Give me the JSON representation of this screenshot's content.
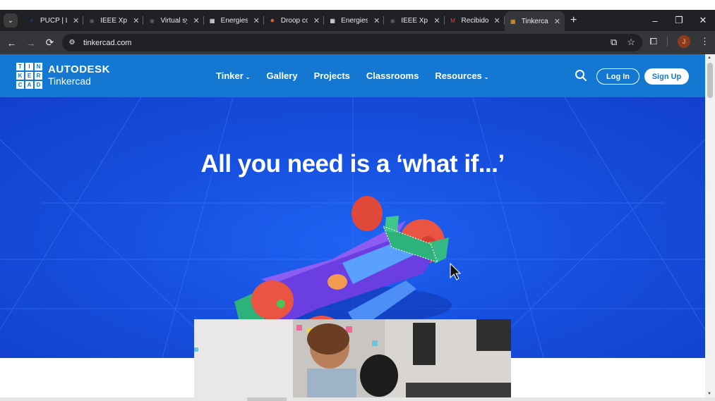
{
  "browser": {
    "tabs": [
      {
        "title": "PUCP | Lo",
        "favicon": "pucp-icon",
        "color": "#1a3b8c"
      },
      {
        "title": "IEEE Xplo",
        "favicon": "globe-icon",
        "color": "#5f6368"
      },
      {
        "title": "Virtual sy",
        "favicon": "globe-icon",
        "color": "#5f6368"
      },
      {
        "title": "Energies |",
        "favicon": "mdpi-icon",
        "color": "#ffffff"
      },
      {
        "title": "Droop co",
        "favicon": "star-icon",
        "color": "#e8632b"
      },
      {
        "title": "Energies |",
        "favicon": "mdpi-icon",
        "color": "#ffffff"
      },
      {
        "title": "IEEE Xplo",
        "favicon": "globe-icon",
        "color": "#5f6368"
      },
      {
        "title": "Recibidos",
        "favicon": "gmail-icon",
        "color": "#ea4335"
      },
      {
        "title": "Tinkercad",
        "favicon": "tinkercad-icon",
        "color": "#f5a623",
        "active": true
      }
    ],
    "url": "tinkercad.com",
    "avatar_letter": "J"
  },
  "header": {
    "logo_letters": [
      "T",
      "I",
      "N",
      "K",
      "E",
      "R",
      "C",
      "A",
      "D"
    ],
    "brand_line1": "AUTODESK",
    "brand_line2": "Tinkercad",
    "nav": [
      {
        "label": "Tinker",
        "has_menu": true
      },
      {
        "label": "Gallery",
        "has_menu": false
      },
      {
        "label": "Projects",
        "has_menu": false
      },
      {
        "label": "Classrooms",
        "has_menu": false
      },
      {
        "label": "Resources",
        "has_menu": true
      }
    ],
    "login_label": "Log In",
    "signup_label": "Sign Up",
    "accent": "#1477d1"
  },
  "hero": {
    "title": "All you need is a ‘what if...’",
    "background": "#1750e0"
  }
}
